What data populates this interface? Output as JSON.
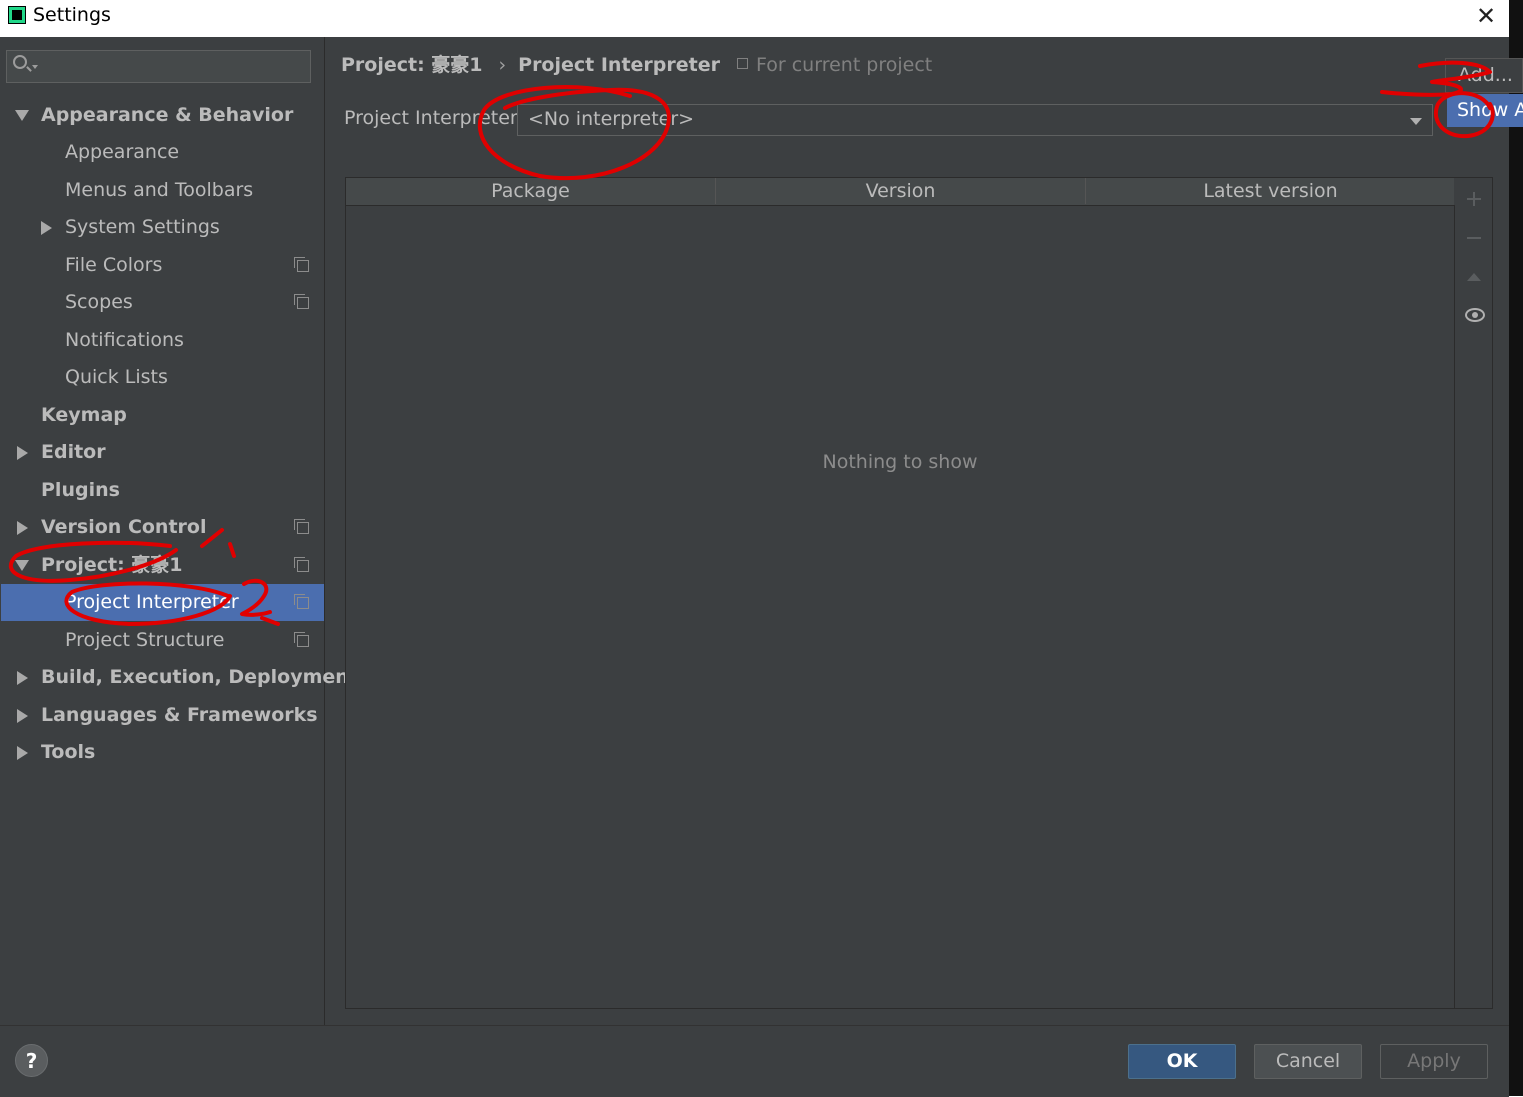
{
  "window": {
    "title": "Settings"
  },
  "sidebar": {
    "search_placeholder": "",
    "items": [
      {
        "label": "Appearance & Behavior"
      },
      {
        "label": "Appearance"
      },
      {
        "label": "Menus and Toolbars"
      },
      {
        "label": "System Settings"
      },
      {
        "label": "File Colors"
      },
      {
        "label": "Scopes"
      },
      {
        "label": "Notifications"
      },
      {
        "label": "Quick Lists"
      },
      {
        "label": "Keymap"
      },
      {
        "label": "Editor"
      },
      {
        "label": "Plugins"
      },
      {
        "label": "Version Control"
      },
      {
        "label": "Project: 豪豪1"
      },
      {
        "label": "Project Interpreter"
      },
      {
        "label": "Project Structure"
      },
      {
        "label": "Build, Execution, Deployment"
      },
      {
        "label": "Languages & Frameworks"
      },
      {
        "label": "Tools"
      }
    ],
    "selected_item": "Project Interpreter"
  },
  "main": {
    "breadcrumb": {
      "project": "Project: 豪豪1",
      "separator": "›",
      "page": "Project Interpreter"
    },
    "scope_note": "For current project",
    "interpreter_label": "Project Interpreter:",
    "interpreter_value": "<No interpreter>",
    "gear_menu": {
      "add": "Add...",
      "show_all": "Show A"
    },
    "table": {
      "columns": [
        "Package",
        "Version",
        "Latest version"
      ],
      "empty_text": "Nothing to show"
    },
    "toolbar": [
      "plus-icon",
      "minus-icon",
      "upgrade-icon",
      "eye-icon"
    ]
  },
  "footer": {
    "help": "?",
    "ok": "OK",
    "cancel": "Cancel",
    "apply": "Apply"
  },
  "colors": {
    "background": "#3c3f41",
    "selection": "#4b6eaf",
    "text": "#bbbbbb",
    "annotation": "#e00000",
    "ok_button": "#365880"
  }
}
